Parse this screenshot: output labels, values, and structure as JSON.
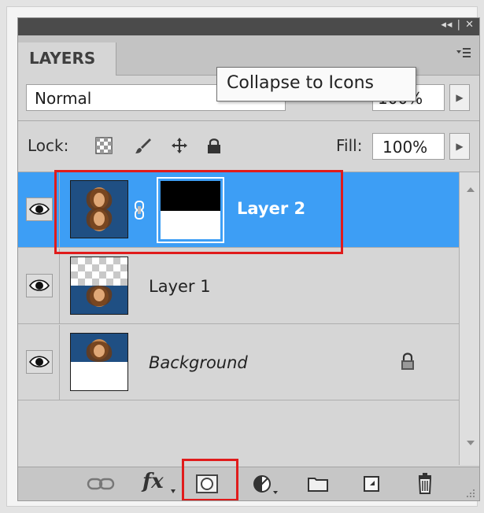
{
  "panel": {
    "title_controls": "◂◂ | ✕",
    "tab_label": "LAYERS",
    "menu_icon": "panel-menu-icon"
  },
  "blend": {
    "mode": "Normal",
    "opacity_value": "100%"
  },
  "tooltip": {
    "text": "Collapse to Icons"
  },
  "lock": {
    "label": "Lock:",
    "fill_label": "Fill:",
    "fill_value": "100%"
  },
  "layers": [
    {
      "name": "Layer 2",
      "selected": true,
      "has_mask": true,
      "visible": true
    },
    {
      "name": "Layer 1",
      "selected": false,
      "has_mask": false,
      "visible": true
    },
    {
      "name": "Background",
      "selected": false,
      "locked": true,
      "visible": true
    }
  ],
  "colors": {
    "selection": "#3d9ef5",
    "highlight_box": "#e01b1b",
    "panel_bg": "#d6d6d6"
  },
  "bottom_icons": [
    "link-layers-icon",
    "fx-icon",
    "add-mask-icon",
    "adjustment-layer-icon",
    "new-group-icon",
    "new-layer-icon",
    "trash-icon"
  ],
  "fx_label": "fx"
}
